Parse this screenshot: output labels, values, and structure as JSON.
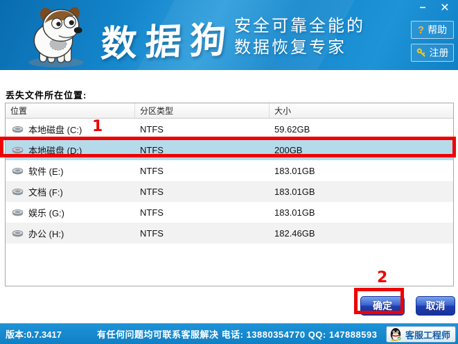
{
  "window": {
    "app_name": "数据狗"
  },
  "header": {
    "logo_text": "数据狗",
    "tagline_line1": "安全可靠全能的",
    "tagline_line2": "数据恢复专家",
    "help_icon": "?",
    "help_label": "帮助",
    "register_label": "注册",
    "minimize_glyph": "–",
    "close_glyph": "✕"
  },
  "main": {
    "section_label": "丢失文件所在位置:",
    "table": {
      "columns": [
        "位置",
        "分区类型",
        "大小"
      ],
      "rows": [
        {
          "name": "本地磁盘 (C:)",
          "type": "NTFS",
          "size": "59.62GB",
          "selected": false
        },
        {
          "name": "本地磁盘 (D:)",
          "type": "NTFS",
          "size": "200GB",
          "selected": true
        },
        {
          "name": "软件 (E:)",
          "type": "NTFS",
          "size": "183.01GB",
          "selected": false
        },
        {
          "name": "文档 (F:)",
          "type": "NTFS",
          "size": "183.01GB",
          "selected": false
        },
        {
          "name": "娱乐 (G:)",
          "type": "NTFS",
          "size": "183.01GB",
          "selected": false
        },
        {
          "name": "办公 (H:)",
          "type": "NTFS",
          "size": "182.46GB",
          "selected": false
        }
      ]
    },
    "annotations": {
      "step1": "1",
      "step2": "2"
    },
    "ok_label": "确定",
    "cancel_label": "取消"
  },
  "statusbar": {
    "version": "版本:0.7.3417",
    "support_text": "有任何问题均可联系客服解决 电话: 13880354770 QQ: 147888593",
    "service_button": "客服工程师"
  },
  "icons": {
    "disk": "disk-icon",
    "help": "question-icon",
    "register": "key-icon",
    "service": "qq-penguin-icon",
    "logo": "dog-mascot-icon"
  },
  "colors": {
    "header_blue": "#1486cc",
    "annotation_red": "#ee0202",
    "selected_row": "#b5dbeb",
    "button_blue": "#2b50c8",
    "statusbar_blue": "#1080c5"
  }
}
